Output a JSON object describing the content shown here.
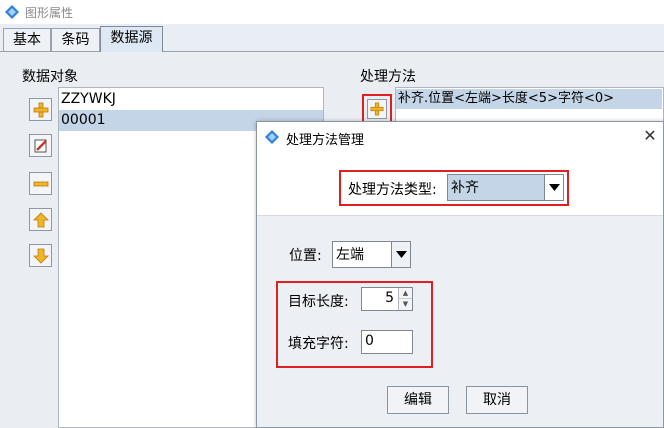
{
  "window": {
    "title": "图形属性",
    "app_icon": "diamond-app-icon"
  },
  "tabs": [
    {
      "label": "基本"
    },
    {
      "label": "条码"
    },
    {
      "label": "数据源"
    }
  ],
  "data_objects": {
    "label": "数据对象",
    "items": [
      "ZZYWKJ",
      "00001"
    ],
    "selected_index": 1,
    "buttons": [
      "add-icon",
      "edit-icon",
      "remove-icon",
      "move-up-icon",
      "move-down-icon"
    ]
  },
  "processing": {
    "label": "处理方法",
    "add_button_icon": "add-icon",
    "items": [
      "补齐.位置<左端>长度<5>字符<0>"
    ]
  },
  "dialog": {
    "title": "处理方法管理",
    "close_glyph": "✕",
    "method_type_label": "处理方法类型:",
    "method_type_value": "补齐",
    "position_label": "位置:",
    "position_value": "左端",
    "target_length_label": "目标长度:",
    "target_length_value": "5",
    "fill_char_label": "填充字符:",
    "fill_char_value": "0",
    "edit_button": "编辑",
    "cancel_button": "取消"
  },
  "colors": {
    "highlight_red": "#e02020",
    "selection": "#c4d5e8",
    "icon_orange": "#f2b325"
  }
}
